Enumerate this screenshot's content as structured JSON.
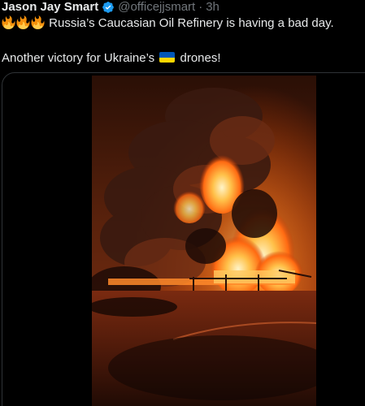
{
  "author": {
    "display_name": "Jason Jay Smart",
    "handle": "@officejjsmart",
    "separator": "·",
    "time": "3h",
    "verified_icon": "verified-badge-icon"
  },
  "tweet": {
    "line1_emoji": [
      "fire-emoji",
      "fire-emoji",
      "fire-emoji"
    ],
    "line1_text": "Russia’s Caucasian Oil Refinery is having a bad day.",
    "line2_before": "Another victory for Ukraine’s",
    "line2_flag": "ukraine-flag-emoji",
    "line2_after": "drones!"
  },
  "media": {
    "type": "video",
    "subject": "night-fire-oil-refinery"
  },
  "colors": {
    "background": "#000000",
    "text": "#e7e9ea",
    "muted": "#71767b",
    "verified": "#1d9bf0",
    "border": "#2f3336"
  }
}
